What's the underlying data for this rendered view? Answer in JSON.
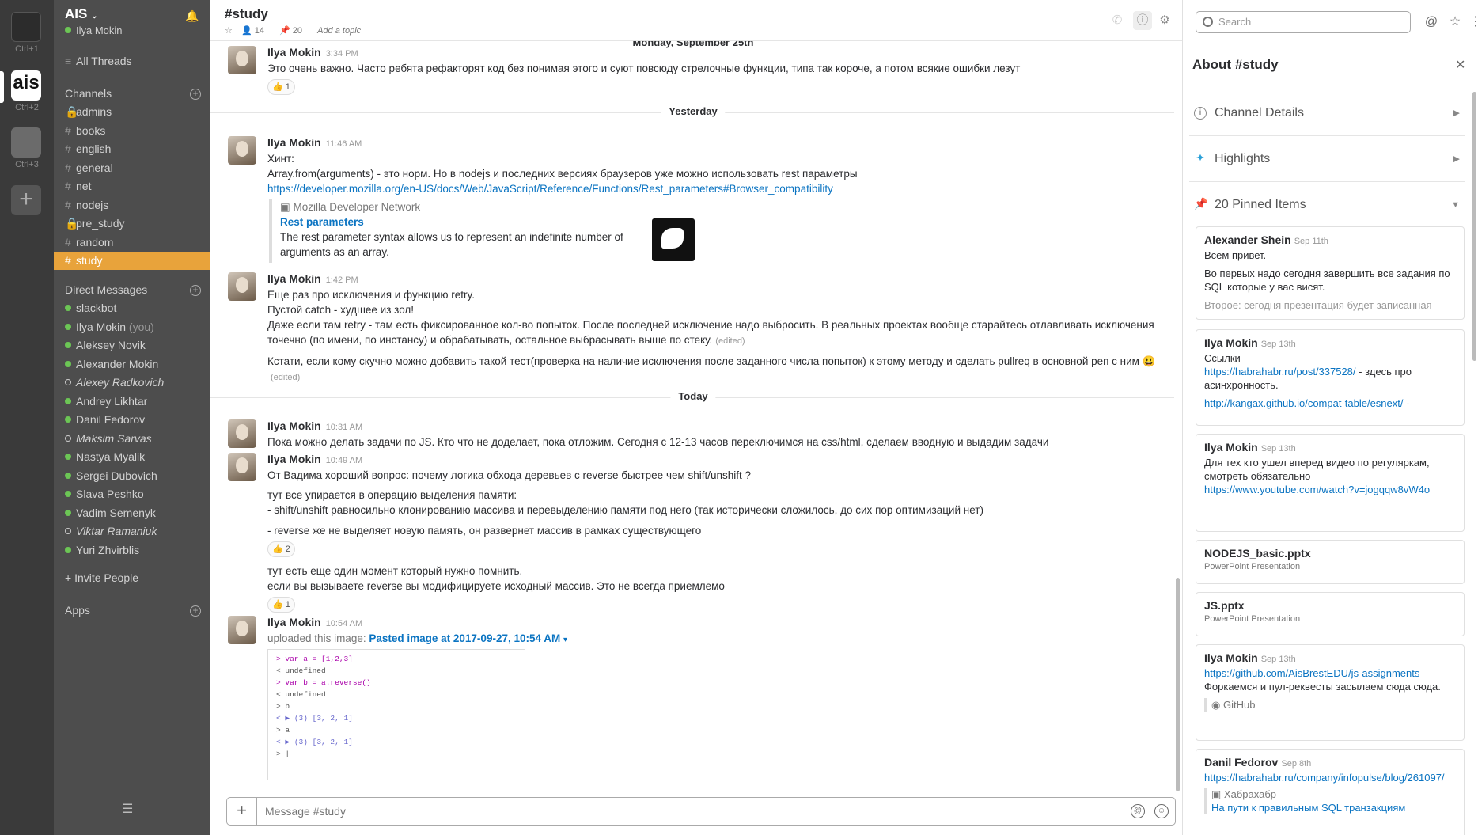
{
  "teams": [
    {
      "label": "Ctrl+1"
    },
    {
      "label": "Ctrl+2",
      "logo_text": "ais"
    },
    {
      "label": "Ctrl+3"
    }
  ],
  "workspace": {
    "name": "AIS",
    "user": "Ilya Mokin"
  },
  "sidebar": {
    "all_threads": "All Threads",
    "channels_header": "Channels",
    "channels": [
      {
        "name": "admins",
        "prefix": "🔒"
      },
      {
        "name": "books",
        "prefix": "#"
      },
      {
        "name": "english",
        "prefix": "#"
      },
      {
        "name": "general",
        "prefix": "#"
      },
      {
        "name": "net",
        "prefix": "#"
      },
      {
        "name": "nodejs",
        "prefix": "#"
      },
      {
        "name": "pre_study",
        "prefix": "🔒"
      },
      {
        "name": "random",
        "prefix": "#"
      },
      {
        "name": "study",
        "prefix": "#",
        "active": true
      }
    ],
    "dm_header": "Direct Messages",
    "dms": [
      {
        "name": "slackbot",
        "status": "bot"
      },
      {
        "name": "Ilya Mokin",
        "suffix": "(you)",
        "status": "online"
      },
      {
        "name": "Aleksey Novik",
        "status": "online"
      },
      {
        "name": "Alexander Mokin",
        "status": "online"
      },
      {
        "name": "Alexey Radkovich",
        "status": "away"
      },
      {
        "name": "Andrey Likhtar",
        "status": "online"
      },
      {
        "name": "Danil Fedorov",
        "status": "online"
      },
      {
        "name": "Maksim Sarvas",
        "status": "away"
      },
      {
        "name": "Nastya Myalik",
        "status": "online"
      },
      {
        "name": "Sergei Dubovich",
        "status": "online"
      },
      {
        "name": "Slava Peshko",
        "status": "online"
      },
      {
        "name": "Vadim Semenyk",
        "status": "online"
      },
      {
        "name": "Viktar Ramaniuk",
        "status": "away"
      },
      {
        "name": "Yuri Zhvirblis",
        "status": "online"
      }
    ],
    "invite": "+ Invite People",
    "apps_header": "Apps"
  },
  "header": {
    "title": "#study",
    "members": "14",
    "pins": "20",
    "add_topic": "Add a topic"
  },
  "messages": {
    "d1": "Monday, September 25th",
    "m1": {
      "author": "Ilya Mokin",
      "time": "3:34 PM",
      "text": "Это очень важно. Часто ребята рефакторят код без понимая этого и суют повсюду стрелочные функции, типа так короче, а потом всякие ошибки лезут",
      "reaction": "👍 1"
    },
    "d2": "Yesterday",
    "m2": {
      "author": "Ilya Mokin",
      "time": "11:46 AM",
      "l1": "Хинт:",
      "l2": "Array.from(arguments) - это норм. Но в nodejs и последних версиях браузеров уже можно использовать rest параметры",
      "link": "https://developer.mozilla.org/en-US/docs/Web/JavaScript/Reference/Functions/Rest_parameters#Browser_compatibility",
      "unfurl_site": "Mozilla Developer Network",
      "unfurl_title": "Rest parameters",
      "unfurl_desc": "The rest parameter syntax allows us to represent an indefinite number of arguments as an array."
    },
    "m3": {
      "author": "Ilya Mokin",
      "time": "1:42 PM",
      "l1": "Еще раз про исключения и функцию retry.",
      "l2": "Пустой catch - худшее из зол!",
      "l3": "Даже если там retry - там есть фиксированное кол-во попыток. После последней исключение надо выбросить. В реальных проектах вообще старайтесь отлавливать исключения точечно (по имени, по инстансу) и обрабатывать, остальное выбрасывать выше по стеку.",
      "edited": "(edited)",
      "l4": "Кстати, если кому скучно можно добавить такой тест(проверка на наличие исключения после заданного числа попыток) к этому методу и сделать pullreq в основной реп с ним 😃"
    },
    "d3": "Today",
    "m4": {
      "author": "Ilya Mokin",
      "time": "10:31 AM",
      "text": "Пока можно делать задачи по JS. Кто что не доделает, пока отложим. Сегодня с 12-13 часов переключимся на css/html, сделаем вводную и выдадим задачи"
    },
    "m5": {
      "author": "Ilya Mokin",
      "time": "10:49 AM",
      "l1": "От Вадима хороший вопрос: почему логика обхода деревьев с reverse быстрее чем shift/unshift ?",
      "l2": "тут все упирается в операцию выделения памяти:",
      "l3": "- shift/unshift равносильно клонированию массива и перевыделению памяти под него (так исторически сложилось, до сих пор оптимизаций нет)",
      "l4": "- reverse же не выделяет новую память, он развернет массив в рамках существующего",
      "r1": "👍 2",
      "l5": "тут есть еще один момент который нужно помнить.",
      "l6": "если вы вызываете reverse вы модифицируете исходный массив. Это не всегда приемлемо",
      "r2": "👍 1"
    },
    "m6": {
      "author": "Ilya Mokin",
      "time": "10:54 AM",
      "uploaded": "uploaded this image:",
      "file": "Pasted image at 2017-09-27, 10:54 AM",
      "code": [
        "> var a = [1,2,3]",
        "< undefined",
        "> var b = a.reverse()",
        "< undefined",
        "> b",
        "< ▶ (3) [3, 2, 1]",
        "> a",
        "< ▶ (3) [3, 2, 1]",
        "> |"
      ]
    }
  },
  "composer": {
    "placeholder": "Message #study"
  },
  "search": {
    "placeholder": "Search"
  },
  "panel": {
    "title": "About #study",
    "sections": [
      "Channel Details",
      "Highlights",
      "20 Pinned Items"
    ],
    "pins": [
      {
        "author": "Alexander Shein",
        "date": "Sep 11th",
        "l1": "Всем привет.",
        "l2": "Во первых надо сегодня завершить все задания по SQL которые у вас висят.",
        "l3": "Второе: сегодня презентация будет записанная"
      },
      {
        "author": "Ilya Mokin",
        "date": "Sep 13th",
        "l1": "Ссылки",
        "link1": "https://habrahabr.ru/post/337528/",
        "l2": " - здесь про асинхронность.",
        "link2": "http://kangax.github.io/compat-table/esnext/",
        "l3": " -"
      },
      {
        "author": "Ilya Mokin",
        "date": "Sep 13th",
        "l1": "Для тех кто ушел вперед видео по регуляркам, смотреть обязательно",
        "link1": "https://www.youtube.com/watch?v=jogqqw8vW4o"
      },
      {
        "file": "NODEJS_basic.pptx",
        "type": "PowerPoint Presentation"
      },
      {
        "file": "JS.pptx",
        "type": "PowerPoint Presentation"
      },
      {
        "author": "Ilya Mokin",
        "date": "Sep 13th",
        "link1": "https://github.com/AisBrestEDU/js-assignments",
        "l1": "Форкаемся и пул-реквесты засылаем сюда сюда.",
        "site": "GitHub"
      },
      {
        "author": "Danil Fedorov",
        "date": "Sep 8th",
        "link1": "https://habrahabr.ru/company/infopulse/blog/261097/",
        "site": "Хабрахабр",
        "l1": "На пути к правильным SQL транзакциям"
      }
    ]
  }
}
